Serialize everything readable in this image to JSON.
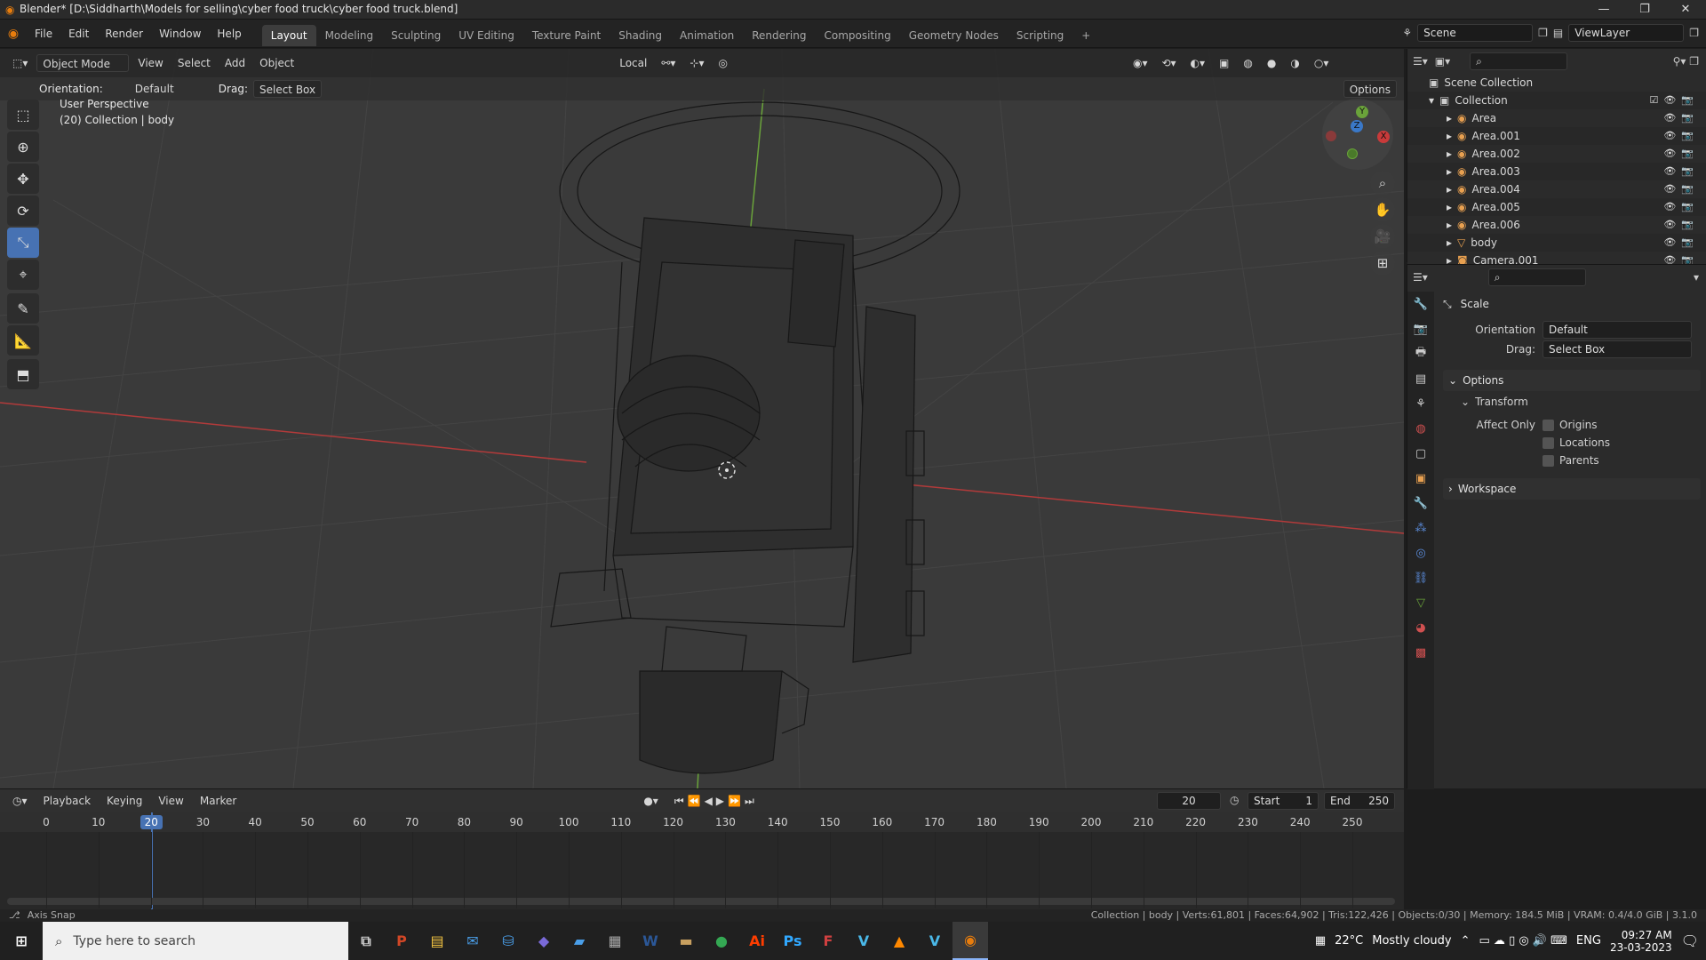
{
  "window": {
    "title": "Blender* [D:\\Siddharth\\Models for selling\\cyber food truck\\cyber food truck.blend]",
    "controls": [
      "—",
      "❐",
      "✕"
    ]
  },
  "menu": [
    "File",
    "Edit",
    "Render",
    "Window",
    "Help"
  ],
  "workspaces": [
    "Layout",
    "Modeling",
    "Sculpting",
    "UV Editing",
    "Texture Paint",
    "Shading",
    "Animation",
    "Rendering",
    "Compositing",
    "Geometry Nodes",
    "Scripting",
    "+"
  ],
  "scene": {
    "name": "Scene",
    "view_layer": "ViewLayer"
  },
  "viewport": {
    "mode": "Object Mode",
    "header_menus": [
      "View",
      "Select",
      "Add",
      "Object"
    ],
    "transform_space": "Local",
    "tool_settings": {
      "orientation_label": "Orientation:",
      "orientation_value": "Default",
      "drag_label": "Drag:",
      "drag_value": "Select Box",
      "options": "Options"
    },
    "overlay_line1": "User Perspective",
    "overlay_line2": "(20) Collection | body",
    "gizmo_axes": {
      "x": "X",
      "y": "Y",
      "z": "Z"
    },
    "colors": {
      "x_axis": "#c83a3a",
      "y_axis": "#7ab33a",
      "z_axis": "#3a78c8",
      "active_tool": "#4772b3"
    }
  },
  "outliner": {
    "scene_collection": "Scene Collection",
    "collection": "Collection",
    "items": [
      {
        "name": "Area"
      },
      {
        "name": "Area.001"
      },
      {
        "name": "Area.002"
      },
      {
        "name": "Area.003"
      },
      {
        "name": "Area.004"
      },
      {
        "name": "Area.005"
      },
      {
        "name": "Area.006"
      },
      {
        "name": "body"
      },
      {
        "name": "Camera.001"
      }
    ]
  },
  "properties": {
    "tool_name": "Scale",
    "orientation_label": "Orientation",
    "orientation_value": "Default",
    "drag_label": "Drag:",
    "drag_value": "Select Box",
    "options_panel": "Options",
    "transform_panel": "Transform",
    "affect_only_label": "Affect Only",
    "affect_only": [
      "Origins",
      "Locations",
      "Parents"
    ],
    "workspace_panel": "Workspace"
  },
  "timeline": {
    "menus": [
      "Playback",
      "Keying",
      "View",
      "Marker"
    ],
    "current_frame": "20",
    "start_label": "Start",
    "start_value": "1",
    "end_label": "End",
    "end_value": "250",
    "ticks": [
      "0",
      "10",
      "20",
      "30",
      "40",
      "50",
      "60",
      "70",
      "80",
      "90",
      "100",
      "110",
      "120",
      "130",
      "140",
      "150",
      "160",
      "170",
      "180",
      "190",
      "200",
      "210",
      "220",
      "230",
      "240",
      "250"
    ]
  },
  "statusbar": {
    "left": "Axis Snap",
    "right": "Collection | body | Verts:61,801 | Faces:64,902 | Tris:122,426 | Objects:0/30 | Memory: 184.5 MiB | VRAM: 0.4/4.0 GiB | 3.1.0"
  },
  "taskbar": {
    "search_placeholder": "Type here to search",
    "apps": [
      "P",
      "▤",
      "✉",
      "⛁",
      "◆",
      "▰",
      "▦",
      "W",
      "▬",
      "●",
      "Ai",
      "Ps",
      "F",
      "V",
      "▲",
      "V",
      "◉"
    ],
    "temperature": "22°C",
    "weather": "Mostly cloudy",
    "language": "ENG",
    "time": "09:27 AM",
    "date": "23-03-2023"
  }
}
